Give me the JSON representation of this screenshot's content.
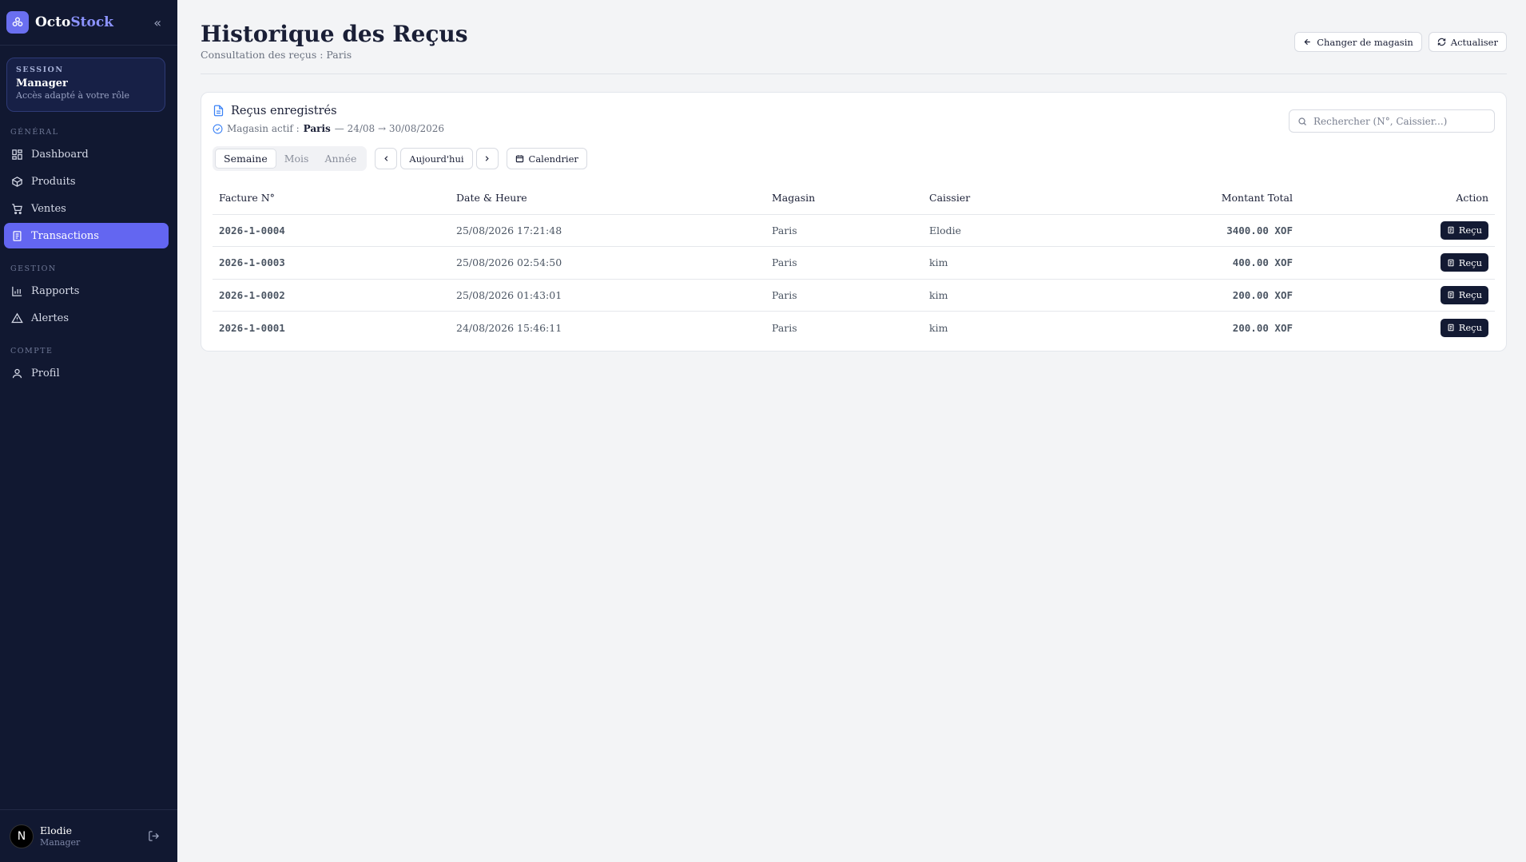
{
  "brand": {
    "part1": "Octo",
    "part2": "Stock"
  },
  "session": {
    "kicker": "SESSION",
    "role": "Manager",
    "description": "Accès adapté à votre rôle"
  },
  "nav": {
    "section_general": "GÉNÉRAL",
    "section_gestion": "GESTION",
    "section_compte": "COMPTE",
    "items": [
      {
        "label": "Dashboard",
        "icon": "dashboard-icon"
      },
      {
        "label": "Produits",
        "icon": "box-icon"
      },
      {
        "label": "Ventes",
        "icon": "cart-icon"
      },
      {
        "label": "Transactions",
        "icon": "receipt-icon",
        "active": true
      },
      {
        "label": "Rapports",
        "icon": "bar-chart-icon"
      },
      {
        "label": "Alertes",
        "icon": "alert-triangle-icon"
      },
      {
        "label": "Profil",
        "icon": "user-icon"
      }
    ]
  },
  "user": {
    "initial": "N",
    "name": "Elodie",
    "role": "Manager"
  },
  "header": {
    "title": "Historique des Reçus",
    "subtitle": "Consultation des reçus : Paris",
    "change_store_label": "Changer de magasin",
    "refresh_label": "Actualiser"
  },
  "card": {
    "title": "Reçus enregistrés",
    "active_store_label": "Magasin actif :",
    "active_store": "Paris",
    "date_range": "— 24/08 → 30/08/2026",
    "search_placeholder": "Rechercher (N°, Caissier...)"
  },
  "filters": {
    "periods": [
      "Semaine",
      "Mois",
      "Année"
    ],
    "selected_period": "Semaine",
    "today_label": "Aujourd'hui",
    "calendar_label": "Calendrier"
  },
  "table": {
    "columns": [
      "Facture N°",
      "Date & Heure",
      "Magasin",
      "Caissier",
      "Montant Total",
      "Action"
    ],
    "action_label": "Reçu",
    "rows": [
      {
        "invoice": "2026-1-0004",
        "datetime": "25/08/2026 17:21:48",
        "store": "Paris",
        "cashier": "Elodie",
        "amount": "3400.00 XOF"
      },
      {
        "invoice": "2026-1-0003",
        "datetime": "25/08/2026 02:54:50",
        "store": "Paris",
        "cashier": "kim",
        "amount": "400.00 XOF"
      },
      {
        "invoice": "2026-1-0002",
        "datetime": "25/08/2026 01:43:01",
        "store": "Paris",
        "cashier": "kim",
        "amount": "200.00 XOF"
      },
      {
        "invoice": "2026-1-0001",
        "datetime": "24/08/2026 15:46:11",
        "store": "Paris",
        "cashier": "kim",
        "amount": "200.00 XOF"
      }
    ]
  },
  "colors": {
    "sidebar_bg": "#111831",
    "accent": "#6366f1",
    "dark_button": "#131a33",
    "page_bg": "#f3f4f6"
  }
}
